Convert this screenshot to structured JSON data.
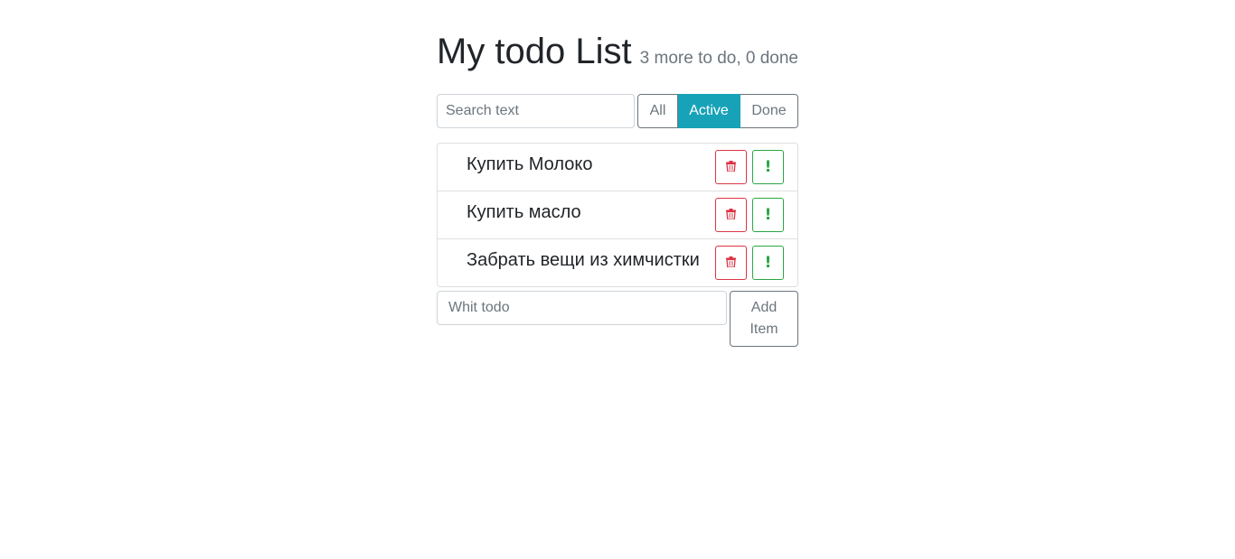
{
  "header": {
    "title": "My todo List",
    "status": "3 more to do, 0 done"
  },
  "search": {
    "placeholder": "Search text",
    "value": ""
  },
  "filters": {
    "all": "All",
    "active": "Active",
    "done": "Done",
    "selected": "Active"
  },
  "todos": [
    {
      "label": "Купить Молоко",
      "done": false,
      "important": false
    },
    {
      "label": "Купить масло",
      "done": false,
      "important": false
    },
    {
      "label": "Забрать вещи из химчистки",
      "done": false,
      "important": false
    }
  ],
  "icons": {
    "delete": "trash-icon",
    "important": "exclamation-icon"
  },
  "colors": {
    "accent": "#17a2b8",
    "danger": "#dc3545",
    "success": "#28a745",
    "secondary": "#6c757d"
  },
  "add_form": {
    "placeholder": "Whit todo",
    "value": "",
    "button_label": "Add Item"
  }
}
